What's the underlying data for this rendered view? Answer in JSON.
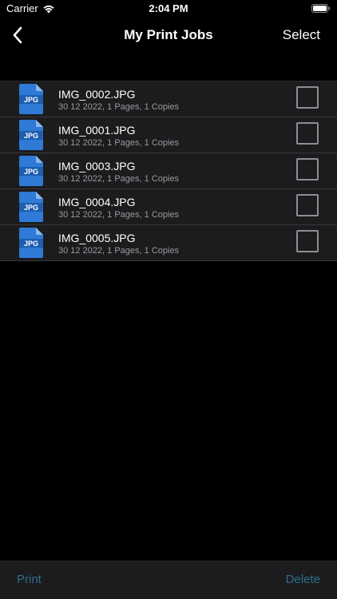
{
  "status_bar": {
    "carrier": "Carrier",
    "time": "2:04 PM"
  },
  "nav": {
    "back_icon": "chevron-left-icon",
    "title": "My Print Jobs",
    "select_label": "Select"
  },
  "jobs": [
    {
      "name": "IMG_0002.JPG",
      "meta": "30 12 2022, 1 Pages, 1 Copies",
      "badge": "JPG",
      "checked": false
    },
    {
      "name": "IMG_0001.JPG",
      "meta": "30 12 2022, 1 Pages, 1 Copies",
      "badge": "JPG",
      "checked": false
    },
    {
      "name": "IMG_0003.JPG",
      "meta": "30 12 2022, 1 Pages, 1 Copies",
      "badge": "JPG",
      "checked": false
    },
    {
      "name": "IMG_0004.JPG",
      "meta": "30 12 2022, 1 Pages, 1 Copies",
      "badge": "JPG",
      "checked": false
    },
    {
      "name": "IMG_0005.JPG",
      "meta": "30 12 2022, 1 Pages, 1 Copies",
      "badge": "JPG",
      "checked": false
    }
  ],
  "toolbar": {
    "print_label": "Print",
    "delete_label": "Delete"
  },
  "colors": {
    "background": "#000000",
    "row_background": "#1c1c1e",
    "file_icon_blue": "#2f7ad6",
    "toolbar_text": "#2e6f8a",
    "meta_text": "#9a9a9e"
  }
}
